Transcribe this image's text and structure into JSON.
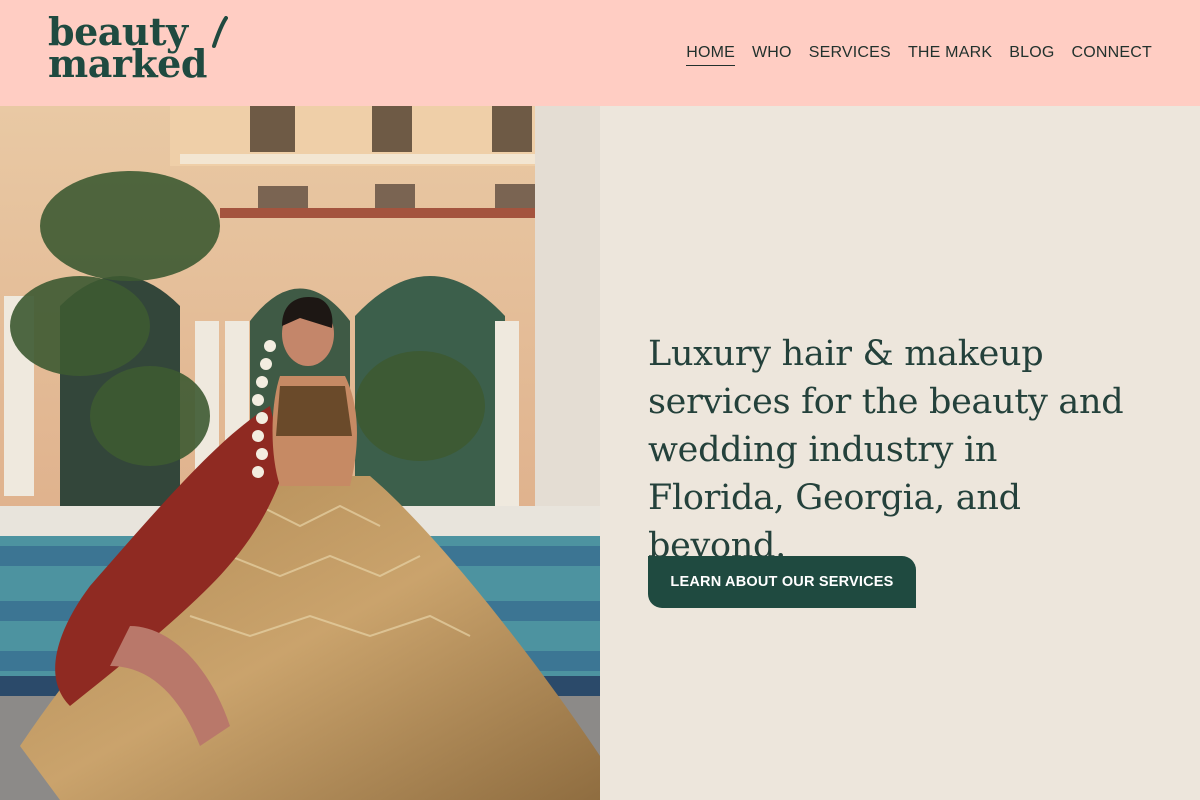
{
  "brand": {
    "line1": "beauty",
    "line2": "marked",
    "color": "#1f4a40"
  },
  "nav": {
    "items": [
      {
        "label": "HOME",
        "active": true
      },
      {
        "label": "WHO"
      },
      {
        "label": "SERVICES"
      },
      {
        "label": "THE MARK"
      },
      {
        "label": "BLOG"
      },
      {
        "label": "CONNECT"
      }
    ]
  },
  "hero": {
    "headline": "Luxury hair & makeup services for the beauty and wedding industry in Florida, Georgia, and beyond.",
    "cta_label": "LEARN ABOUT OUR SERVICES"
  },
  "colors": {
    "header_bg": "#ffcdc3",
    "page_bg": "#ede6dc",
    "accent": "#1f4a40",
    "text": "#24413b"
  }
}
